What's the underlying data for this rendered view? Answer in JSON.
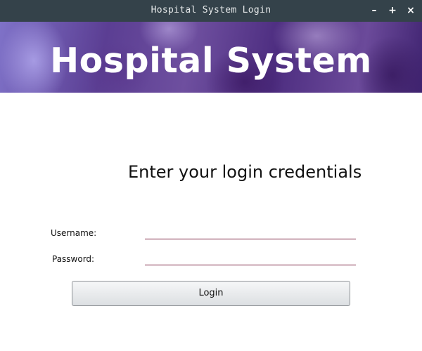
{
  "window": {
    "title": "Hospital System Login",
    "controls": {
      "minimize": "–",
      "maximize": "+",
      "close": "×"
    }
  },
  "banner": {
    "heading": "Hospital System"
  },
  "form": {
    "prompt": "Enter your login credentials",
    "username_label": "Username:",
    "username_value": "",
    "password_label": "Password:",
    "password_value": "",
    "login_label": "Login"
  },
  "colors": {
    "titlebar": "#34424a",
    "field_underline": "#7a1f3f",
    "banner_base": "#5b3e93"
  }
}
